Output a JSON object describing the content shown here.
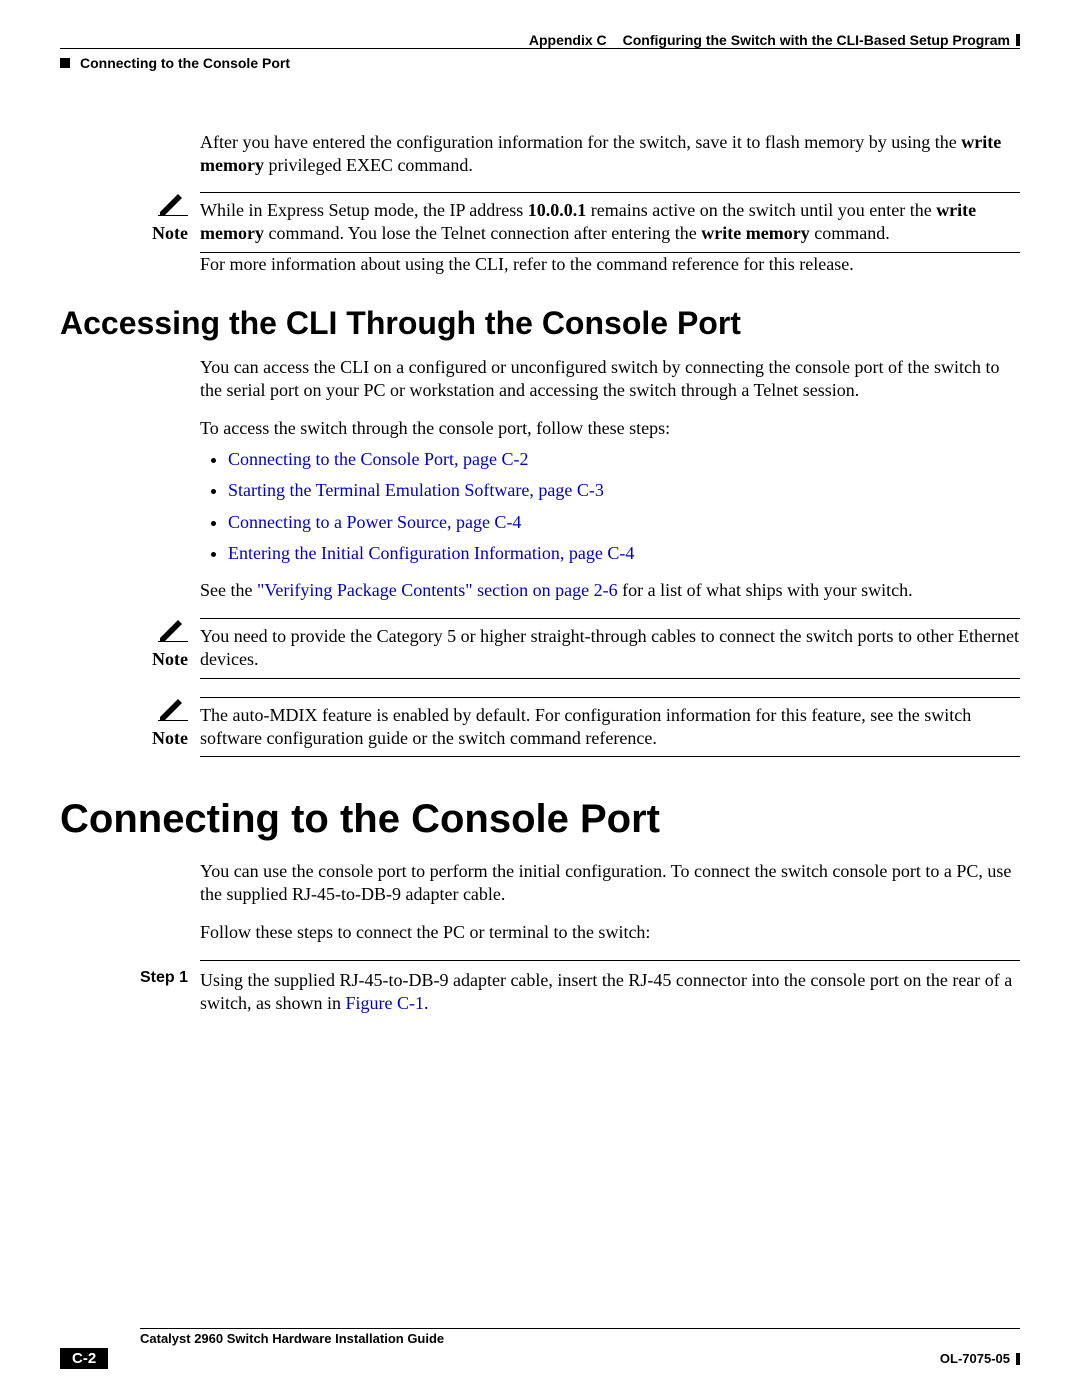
{
  "header": {
    "appendix_label": "Appendix C",
    "appendix_title": "Configuring the Switch with the CLI-Based Setup Program",
    "section_label": "Connecting to the Console Port"
  },
  "body": {
    "intro_para_1a": "After you have entered the configuration information for the switch, save it to flash memory by using the ",
    "intro_para_1_cmd": "write memory",
    "intro_para_1b": " privileged EXEC command.",
    "note1_label": "Note",
    "note1_a": "While in Express Setup mode, the IP address ",
    "note1_ip": "10.0.0.1",
    "note1_b": " remains active on the switch until you enter the ",
    "note1_cmd1": "write memory",
    "note1_c": "  command. You lose the Telnet connection after entering the ",
    "note1_cmd2": "write memory",
    "note1_d": " command.",
    "para_more_info": "For more information about using the CLI, refer to the command reference for this release.",
    "h2_accessing": "Accessing the CLI Through the Console Port",
    "accessing_p1": "You can access the CLI on a configured or unconfigured switch by connecting the console port of the switch to the serial port on your PC or workstation and accessing the switch through a Telnet session.",
    "accessing_p2": "To access the switch through the console port, follow these steps:",
    "bullets": {
      "b1": "Connecting to the Console Port, page C-2",
      "b2": "Starting the Terminal Emulation Software, page C-3",
      "b3": "Connecting to a Power Source, page C-4",
      "b4": "Entering the Initial Configuration Information, page C-4"
    },
    "see_the_a": "See the ",
    "see_the_link": "\"Verifying Package Contents\" section on page 2-6",
    "see_the_b": " for a list of what ships with your switch.",
    "note2_label": "Note",
    "note2_text": "You need to provide the Category 5 or higher straight-through cables to connect the switch ports to other Ethernet devices.",
    "note3_label": "Note",
    "note3_text": "The auto-MDIX feature is enabled by default. For configuration information for this feature, see the switch software configuration guide or the switch command reference.",
    "h3_connecting": "Connecting to the Console Port",
    "connecting_p1": "You can use the console port to perform the initial configuration. To connect the switch console port to a PC, use the supplied RJ-45-to-DB-9 adapter cable.",
    "connecting_p2": "Follow these steps to connect the PC or terminal to the switch:",
    "step1_label": "Step 1",
    "step1_a": "Using the supplied RJ-45-to-DB-9 adapter cable, insert the RJ-45 connector into the console port on the rear of a switch, as shown in ",
    "step1_link": "Figure C-1",
    "step1_b": "."
  },
  "footer": {
    "guide_title": "Catalyst 2960 Switch Hardware Installation Guide",
    "page_number": "C-2",
    "pub_id": "OL-7075-05"
  }
}
